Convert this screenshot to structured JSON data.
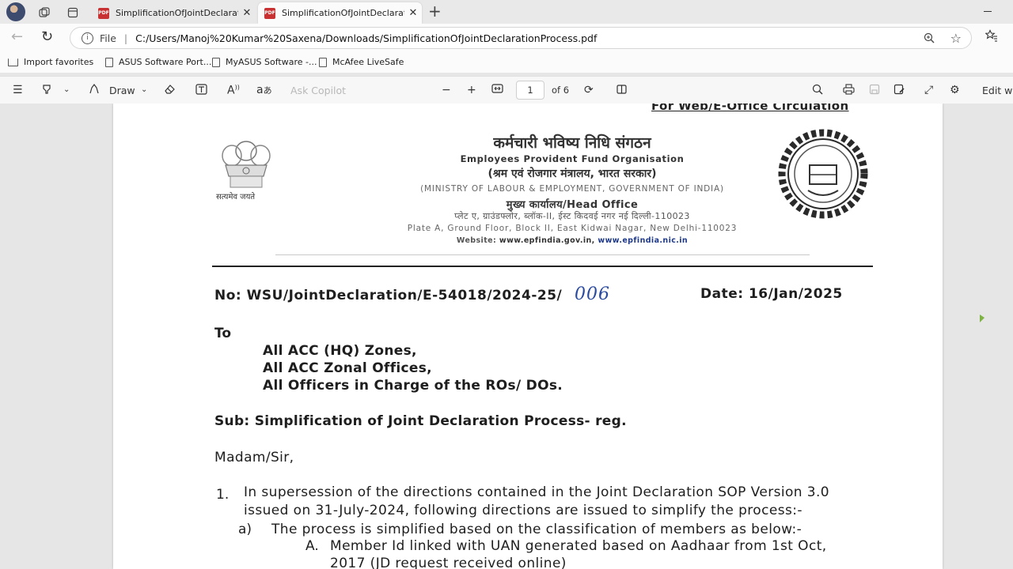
{
  "browser": {
    "tabs": [
      {
        "title": "SimplificationOfJointDeclarationP"
      },
      {
        "title": "SimplificationOfJointDeclarationP"
      }
    ],
    "new_tab_symbol": "+",
    "close_symbol": "✕",
    "address": {
      "scheme_label": "File",
      "url": "C:/Users/Manoj%20Kumar%20Saxena/Downloads/SimplificationOfJointDeclarationProcess.pdf"
    },
    "bookmarks": [
      {
        "label": "Import favorites"
      },
      {
        "label": "ASUS Software Port..."
      },
      {
        "label": "MyASUS Software -..."
      },
      {
        "label": "McAfee LiveSafe"
      }
    ]
  },
  "pdf_toolbar": {
    "draw_label": "Draw",
    "copilot_placeholder": "Ask Copilot",
    "current_page": "1",
    "page_total": "of 6",
    "edit_with_label": "Edit wit"
  },
  "document": {
    "circulation": "For Web/E-Office Circulation",
    "emblem_motto": "सत्यमेव जयते",
    "org_hindi": "कर्मचारी भविष्य निधि संगठन",
    "org_english": "Employees Provident Fund Organisation",
    "ministry_hindi": "(श्रम एवं रोजगार मंत्रालय, भारत सरकार)",
    "ministry_english": "(MINISTRY OF LABOUR & EMPLOYMENT, GOVERNMENT OF INDIA)",
    "office_label": "मुख्य कार्यालय/Head Office",
    "address_hindi": "प्लेट ए, ग्राउंडफ्लोर, ब्लॉक-II, ईस्ट किदवई नगर नई दिल्ली-110023",
    "address_english": "Plate A, Ground Floor, Block II, East Kidwai Nagar, New Delhi-110023",
    "website_prefix": "Website: ",
    "website_1": "www.epfindia.gov.in,",
    "website_2": " www.epfindia.nic.in",
    "ref_no": "No: WSU/JointDeclaration/E-54018/2024-25/",
    "ref_handwritten": "006",
    "date_line": "Date:  16/Jan/2025",
    "to_label": "To",
    "addressees": [
      "All ACC (HQ) Zones,",
      "All ACC Zonal Offices,",
      "All Officers in Charge of the ROs/ DOs."
    ],
    "subject": "Sub: Simplification of Joint Declaration Process- reg.",
    "salutation": "Madam/Sir,",
    "para_number": "1.",
    "para_line1": "In supersession of the directions contained in the Joint Declaration SOP Version 3.0",
    "para_line2": "issued on 31-July-2024, following directions are issued to simplify the process:-",
    "sub_a_label": "a)",
    "sub_a_text": "The process is simplified based on the classification of members as below:-",
    "sub_A_label": "A.",
    "sub_A_text": "Member Id linked with UAN generated based on Aadhaar from 1st Oct,",
    "sub_A_line2": "2017 (JD request received online)"
  }
}
